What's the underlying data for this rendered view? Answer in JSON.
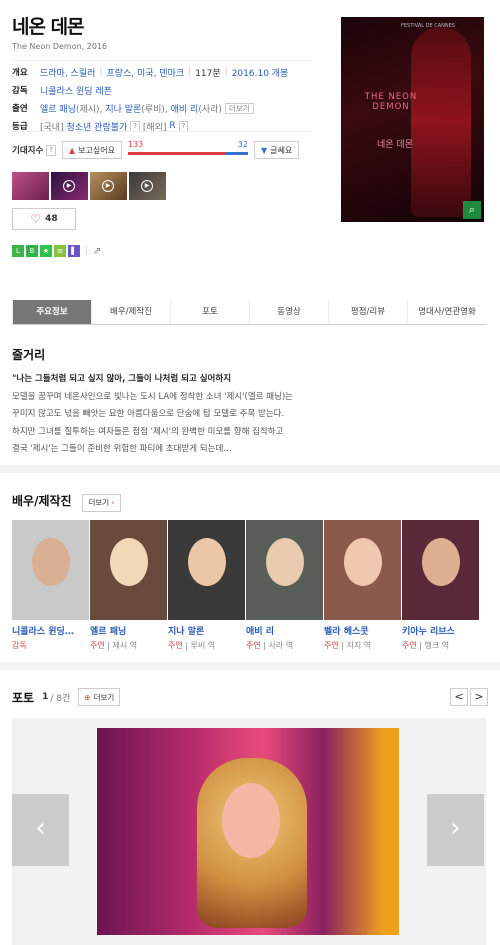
{
  "movie": {
    "title": "네온 데몬",
    "subtitle": "The Neon Demon, 2016"
  },
  "info": {
    "overview_label": "개요",
    "genres": "드라마, 스릴러",
    "countries": "프랑스, 미국, 덴마크",
    "runtime": "117분",
    "release": "2016.10 개봉",
    "director_label": "감독",
    "director": "니콜라스 윈딩 레픈",
    "cast_label": "출연",
    "cast_1": "엘르 패닝",
    "cast_1_role": "(제시),",
    "cast_2": "지나 말론",
    "cast_2_role": "(루비),",
    "cast_3": "애비 리",
    "cast_3_role": "(사라)",
    "cast_more": "더보기",
    "rating_label": "등급",
    "rating_region": "[국내]",
    "rating_kr": "청소년 관람불가",
    "rating_overseas_region": "[해외]",
    "rating_overseas": "R"
  },
  "expect": {
    "label": "기대지수",
    "want_button": "보고싶어요",
    "want_count": "133",
    "not_count": "32",
    "want_ratio": 0.806,
    "not_button": "글쎄요"
  },
  "likes": "48",
  "poster": {
    "title_lines": "THE NEON DEMON",
    "korean": "네온 데몬",
    "festival": "FESTIVAL DE CANNES"
  },
  "tabs": [
    "주요정보",
    "배우/제작진",
    "포토",
    "동영상",
    "평점/리뷰",
    "명대사/연관영화"
  ],
  "synopsis": {
    "heading": "줄거리",
    "tagline": "\"나는 그들처럼 되고 싶지 않아, 그들이 나처럼 되고 싶어하지",
    "line1": "모델을 꿈꾸며 네온사인으로 빛나는 도시 LA에 정착한 소녀 '제시'(엘르 패닝)는",
    "line2": "꾸미지 않고도 넋을 빼앗는 묘한 아름다움으로 단숨에 탑 모델로 주목 받는다.",
    "line3": "하지만 그녀를 질투하는 여자들은 점점 '제시'의 완벽한 미모를 향해 집착하고",
    "line4": "결국 '제시'는 그들이 준비한 위험한 파티에 초대받게 되는데…"
  },
  "cast_section": {
    "heading": "배우/제작진",
    "more": "더보기",
    "members": [
      {
        "name": "니콜라스 윈딩…",
        "role": "감독",
        "character": ""
      },
      {
        "name": "엘르 패닝",
        "role": "주연",
        "character": "제시 역"
      },
      {
        "name": "지나 말론",
        "role": "주연",
        "character": "루비 역"
      },
      {
        "name": "애비 리",
        "role": "주연",
        "character": "사라 역"
      },
      {
        "name": "벨라 헤스콧",
        "role": "주연",
        "character": "지지 역"
      },
      {
        "name": "키아누 리브스",
        "role": "주연",
        "character": "행크 역"
      }
    ]
  },
  "photo_section": {
    "heading": "포토",
    "page": "1",
    "total": "/ 8건",
    "more": "더보기",
    "prev": "<",
    "next": ">"
  }
}
